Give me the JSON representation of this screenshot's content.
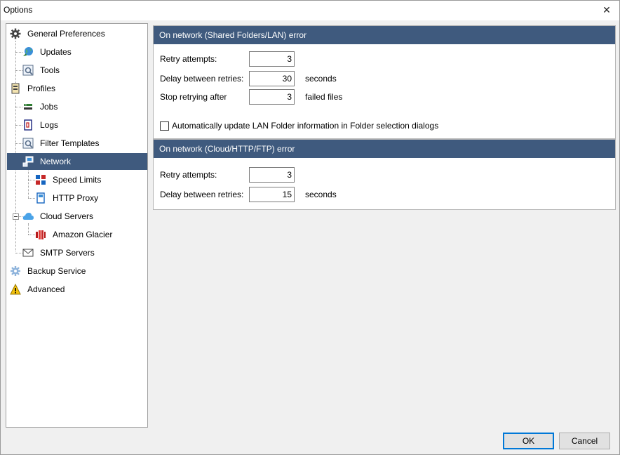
{
  "window": {
    "title": "Options",
    "close_glyph": "✕"
  },
  "tree": {
    "items": [
      {
        "label": "General Preferences",
        "icon": "gear-icon"
      },
      {
        "label": "Updates",
        "icon": "globe-icon"
      },
      {
        "label": "Tools",
        "icon": "tools-icon"
      },
      {
        "label": "Profiles",
        "icon": "profiles-icon"
      },
      {
        "label": "Jobs",
        "icon": "jobs-icon"
      },
      {
        "label": "Logs",
        "icon": "logs-icon"
      },
      {
        "label": "Filter Templates",
        "icon": "filter-icon"
      },
      {
        "label": "Network",
        "icon": "network-icon",
        "selected": true
      },
      {
        "label": "Speed Limits",
        "icon": "speed-icon"
      },
      {
        "label": "HTTP Proxy",
        "icon": "proxy-icon"
      },
      {
        "label": "Cloud Servers",
        "icon": "cloud-icon"
      },
      {
        "label": "Amazon Glacier",
        "icon": "amazon-glacier-icon"
      },
      {
        "label": "SMTP Servers",
        "icon": "mail-icon"
      },
      {
        "label": "Backup Service",
        "icon": "service-gear-icon"
      },
      {
        "label": "Advanced",
        "icon": "warning-icon"
      }
    ]
  },
  "lan_section": {
    "header": "On network (Shared Folders/LAN) error",
    "retry_label": "Retry attempts:",
    "retry_value": "3",
    "delay_label": "Delay between retries:",
    "delay_value": "30",
    "delay_unit": "seconds",
    "stop_label": "Stop retrying after",
    "stop_value": "3",
    "stop_unit": "failed files",
    "auto_update_label": "Automatically update LAN Folder information in Folder selection dialogs",
    "auto_update_checked": false
  },
  "cloud_section": {
    "header": "On network (Cloud/HTTP/FTP) error",
    "retry_label": "Retry attempts:",
    "retry_value": "3",
    "delay_label": "Delay between retries:",
    "delay_value": "15",
    "delay_unit": "seconds"
  },
  "buttons": {
    "ok": "OK",
    "cancel": "Cancel"
  },
  "colors": {
    "accent": "#3f5a7e",
    "default_button_border": "#0078d7"
  }
}
